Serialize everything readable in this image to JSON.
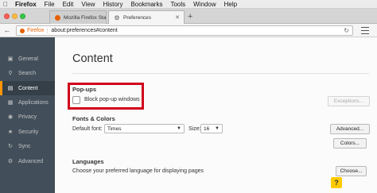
{
  "menubar": {
    "apple_icon": "apple-icon",
    "items": [
      "Firefox",
      "File",
      "Edit",
      "View",
      "History",
      "Bookmarks",
      "Tools",
      "Window",
      "Help"
    ]
  },
  "tabs": [
    {
      "label": "Mozilla Firefox Start Page",
      "icon": "firefox-favicon-icon",
      "active": false
    },
    {
      "label": "Preferences",
      "icon": "gear-icon",
      "active": true
    }
  ],
  "navbar": {
    "identity_label": "Firefox",
    "url": "about:preferences#content"
  },
  "sidebar": {
    "items": [
      {
        "label": "General",
        "icon": "general-icon"
      },
      {
        "label": "Search",
        "icon": "search-icon"
      },
      {
        "label": "Content",
        "icon": "content-icon",
        "selected": true
      },
      {
        "label": "Applications",
        "icon": "applications-icon"
      },
      {
        "label": "Privacy",
        "icon": "privacy-icon"
      },
      {
        "label": "Security",
        "icon": "security-icon"
      },
      {
        "label": "Sync",
        "icon": "sync-icon"
      },
      {
        "label": "Advanced",
        "icon": "advanced-icon"
      }
    ]
  },
  "content": {
    "title": "Content",
    "popups": {
      "heading": "Pop-ups",
      "block_label": "Block pop-up windows",
      "exceptions_button": "Exceptions..."
    },
    "fonts": {
      "heading": "Fonts & Colors",
      "default_font_label": "Default font:",
      "default_font_value": "Times",
      "size_label": "Size:",
      "size_value": "16",
      "advanced_button": "Advanced...",
      "colors_button": "Colors..."
    },
    "languages": {
      "heading": "Languages",
      "description": "Choose your preferred language for displaying pages",
      "choose_button": "Choose..."
    },
    "help_label": "?"
  },
  "colors": {
    "sidebar_bg": "#424f5a",
    "selected_accent": "#ff9500",
    "highlight_border": "#d0021b",
    "help_button": "#ffcb00"
  }
}
